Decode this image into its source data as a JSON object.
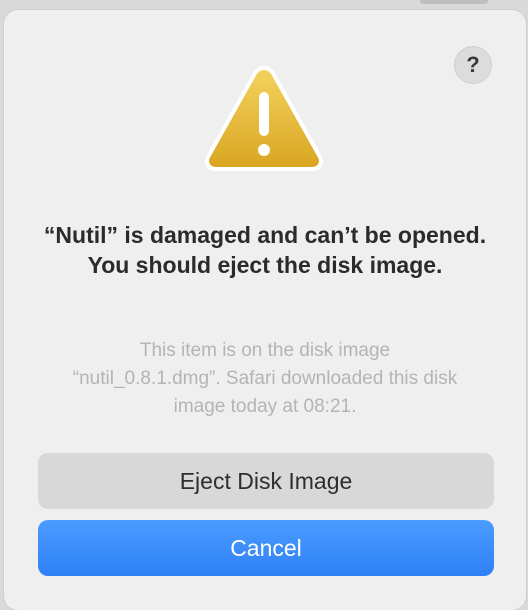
{
  "dialog": {
    "help_label": "?",
    "title": "“Nutil” is damaged and can’t be opened. You should eject the disk image.",
    "message": "This item is on the disk image “nutil_0.8.1.dmg”. Safari downloaded this disk image today at 08:21.",
    "buttons": {
      "eject_label": "Eject Disk Image",
      "cancel_label": "Cancel"
    },
    "icon": "warning-icon",
    "accent_color": "#2f80f6"
  }
}
